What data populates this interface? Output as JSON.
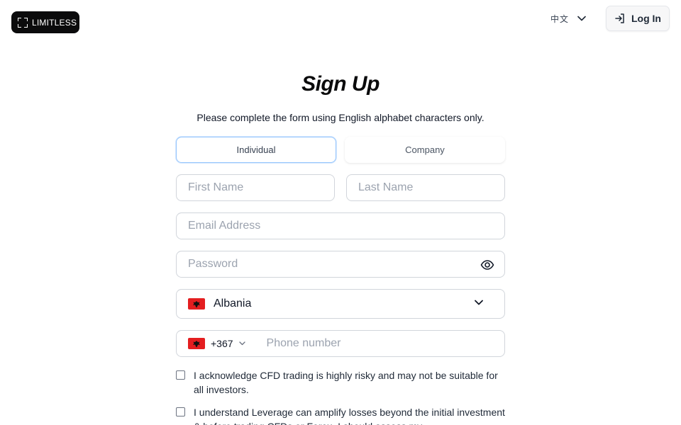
{
  "header": {
    "logo_text": "LIMITLESS",
    "language_label": "中文",
    "login_label": "Log In"
  },
  "form": {
    "title": "Sign Up",
    "subtitle": "Please complete the form using English alphabet characters only.",
    "tabs": [
      {
        "label": "Individual",
        "active": true
      },
      {
        "label": "Company",
        "active": false
      }
    ],
    "first_name_placeholder": "First Name",
    "last_name_placeholder": "Last Name",
    "email_placeholder": "Email Address",
    "password_placeholder": "Password",
    "country": {
      "selected": "Albania",
      "flag": "albania-flag"
    },
    "phone": {
      "dial_code": "+367",
      "placeholder": "Phone number"
    },
    "checkboxes": [
      {
        "text": "I acknowledge CFD trading is highly risky and may not be suitable for all investors.",
        "checked": false
      },
      {
        "text": "I understand Leverage can amplify losses beyond the initial investment & before trading CFDs or Forex, I should assess my",
        "checked": false
      }
    ]
  },
  "colors": {
    "logo_bg": "#0b0b0c",
    "active_tab_border": "#93c5fd",
    "flag_red": "#e41e20"
  }
}
